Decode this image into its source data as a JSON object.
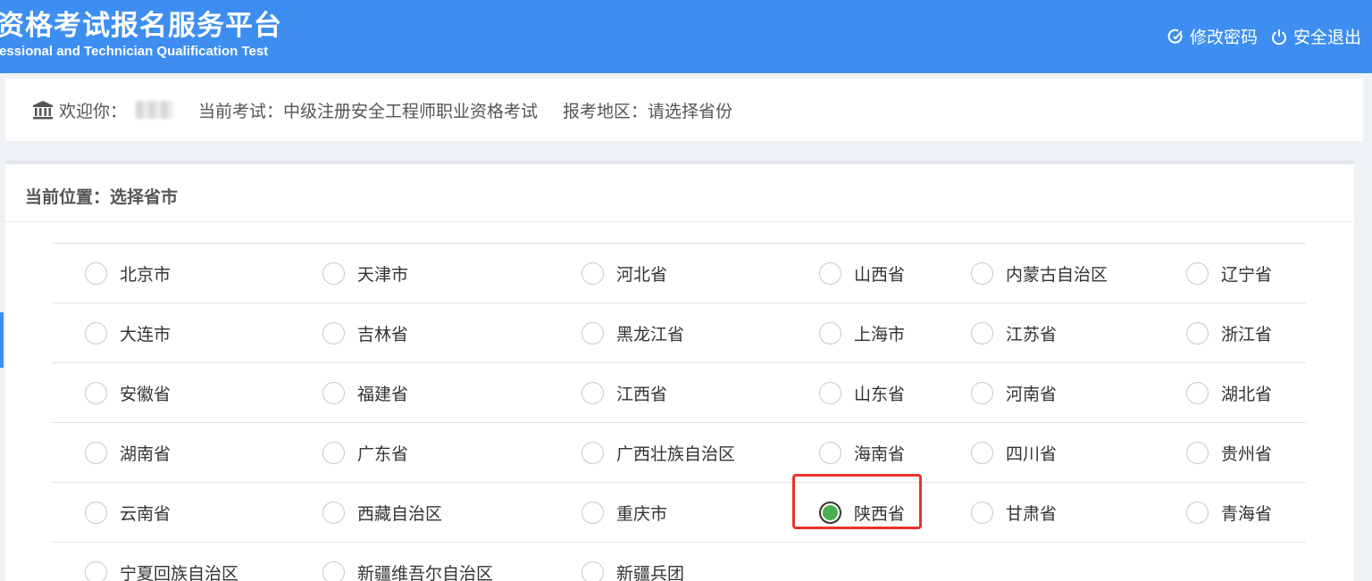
{
  "header": {
    "title": "资格考试报名服务平台",
    "subtitle": "fessional and Technician Qualification Test",
    "change_password": "修改密码",
    "logout": "安全退出"
  },
  "infobar": {
    "welcome": "欢迎你：",
    "current_exam": "当前考试：中级注册安全工程师职业资格考试",
    "region": "报考地区：请选择省份"
  },
  "breadcrumb": "当前位置：选择省市",
  "selected": "陕西省",
  "rows": [
    [
      "北京市",
      "天津市",
      "河北省",
      "山西省",
      "内蒙古自治区",
      "辽宁省"
    ],
    [
      "大连市",
      "吉林省",
      "黑龙江省",
      "上海市",
      "江苏省",
      "浙江省"
    ],
    [
      "安徽省",
      "福建省",
      "江西省",
      "山东省",
      "河南省",
      "湖北省"
    ],
    [
      "湖南省",
      "广东省",
      "广西壮族自治区",
      "海南省",
      "四川省",
      "贵州省"
    ],
    [
      "云南省",
      "西藏自治区",
      "重庆市",
      "陕西省",
      "甘肃省",
      "青海省"
    ],
    [
      "宁夏回族自治区",
      "新疆维吾尔自治区",
      "新疆兵团"
    ]
  ],
  "colors": {
    "header": "#3d8ef0",
    "selected": "#4caf50",
    "highlight": "#e8322b"
  }
}
